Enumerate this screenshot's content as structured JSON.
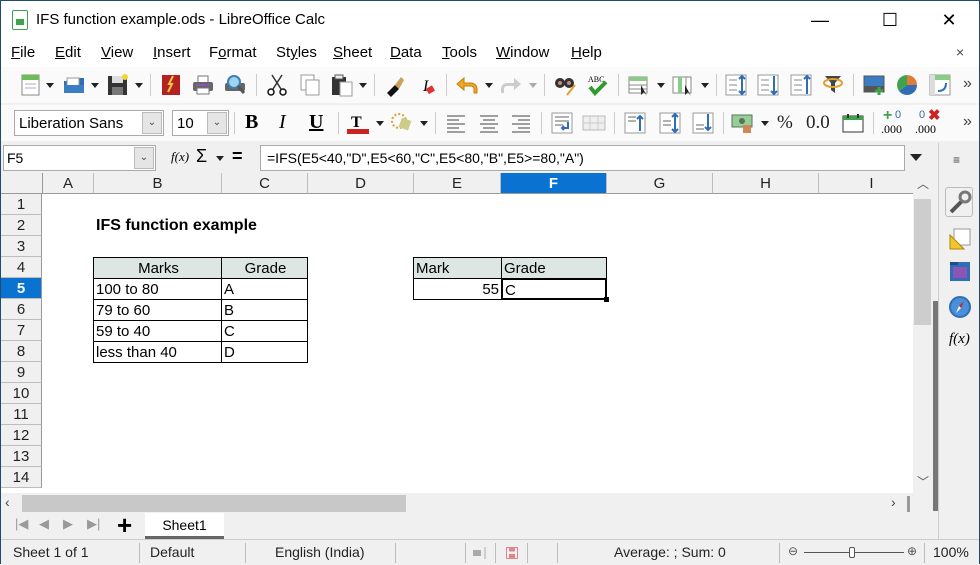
{
  "window": {
    "title": "IFS function example.ods - LibreOffice Calc",
    "minimize": "—",
    "maximize": "☐",
    "close": "✕"
  },
  "menubar": {
    "items": [
      {
        "label": "File",
        "accel": "F",
        "rest": "ile"
      },
      {
        "label": "Edit",
        "accel": "E",
        "rest": "dit"
      },
      {
        "label": "View",
        "accel": "V",
        "rest": "iew"
      },
      {
        "label": "Insert",
        "accel": "I",
        "rest": "nsert"
      },
      {
        "label": "Format",
        "pre": "F",
        "accel": "o",
        "rest": "rmat"
      },
      {
        "label": "Styles",
        "pre": "St",
        "accel": "y",
        "rest": "les"
      },
      {
        "label": "Sheet",
        "accel": "S",
        "rest": "heet"
      },
      {
        "label": "Data",
        "accel": "D",
        "rest": "ata"
      },
      {
        "label": "Tools",
        "accel": "T",
        "rest": "ools"
      },
      {
        "label": "Window",
        "accel": "W",
        "rest": "indow"
      },
      {
        "label": "Help",
        "accel": "H",
        "rest": "elp"
      }
    ],
    "close_doc": "×"
  },
  "toolbar_standard": {
    "icons": [
      "new-icon",
      "open-icon",
      "save-icon",
      "export-pdf-icon",
      "print-icon",
      "print-preview-icon",
      "cut-icon",
      "copy-icon",
      "paste-icon",
      "clone-formatting-icon",
      "clear-formatting-icon",
      "undo-icon",
      "redo-icon",
      "find-replace-icon",
      "spellcheck-icon",
      "row-icon",
      "column-icon",
      "sort-icon",
      "sort-descending-icon",
      "sort-ascending-icon",
      "autofilter-icon",
      "insert-image-icon",
      "insert-chart-icon",
      "pivot-table-icon"
    ],
    "overflow": "»"
  },
  "toolbar_formatting": {
    "font_name": "Liberation Sans",
    "font_size": "10",
    "bold": "B",
    "italic": "I",
    "underline": "U",
    "percent": "%",
    "number_format": "0.0",
    "add_decimal": ".000",
    "delete_decimal": ".000",
    "overflow": "»"
  },
  "formula_bar": {
    "name_box": "F5",
    "function_wizard": "f(x)",
    "sum": "Σ",
    "equals": "=",
    "formula": "=IFS(E5<40,\"D\",E5<60,\"C\",E5<80,\"B\",E5>=80,\"A\")"
  },
  "sheet": {
    "columns": [
      "A",
      "B",
      "C",
      "D",
      "E",
      "F",
      "G",
      "H",
      "I"
    ],
    "selected_column": "F",
    "rows": [
      "1",
      "2",
      "3",
      "4",
      "5",
      "6",
      "7",
      "8",
      "9",
      "10",
      "11",
      "12",
      "13",
      "14"
    ],
    "selected_row": "5",
    "title_cell": "IFS function example",
    "grade_table": {
      "headers": [
        "Marks",
        "Grade"
      ],
      "rows": [
        [
          "100 to 80",
          "A"
        ],
        [
          "79 to 60",
          "B"
        ],
        [
          "59 to 40",
          "C"
        ],
        [
          "less than 40",
          "D"
        ]
      ]
    },
    "lookup_table": {
      "headers": [
        "Mark",
        "Grade"
      ],
      "mark": "55",
      "grade": "C"
    }
  },
  "sheet_tabs": {
    "add": "+",
    "tabs": [
      "Sheet1"
    ]
  },
  "statusbar": {
    "sheet_info": "Sheet 1 of 1",
    "page_style": "Default",
    "language": "English (India)",
    "summary": "Average: ; Sum: 0",
    "zoom": "100%"
  }
}
